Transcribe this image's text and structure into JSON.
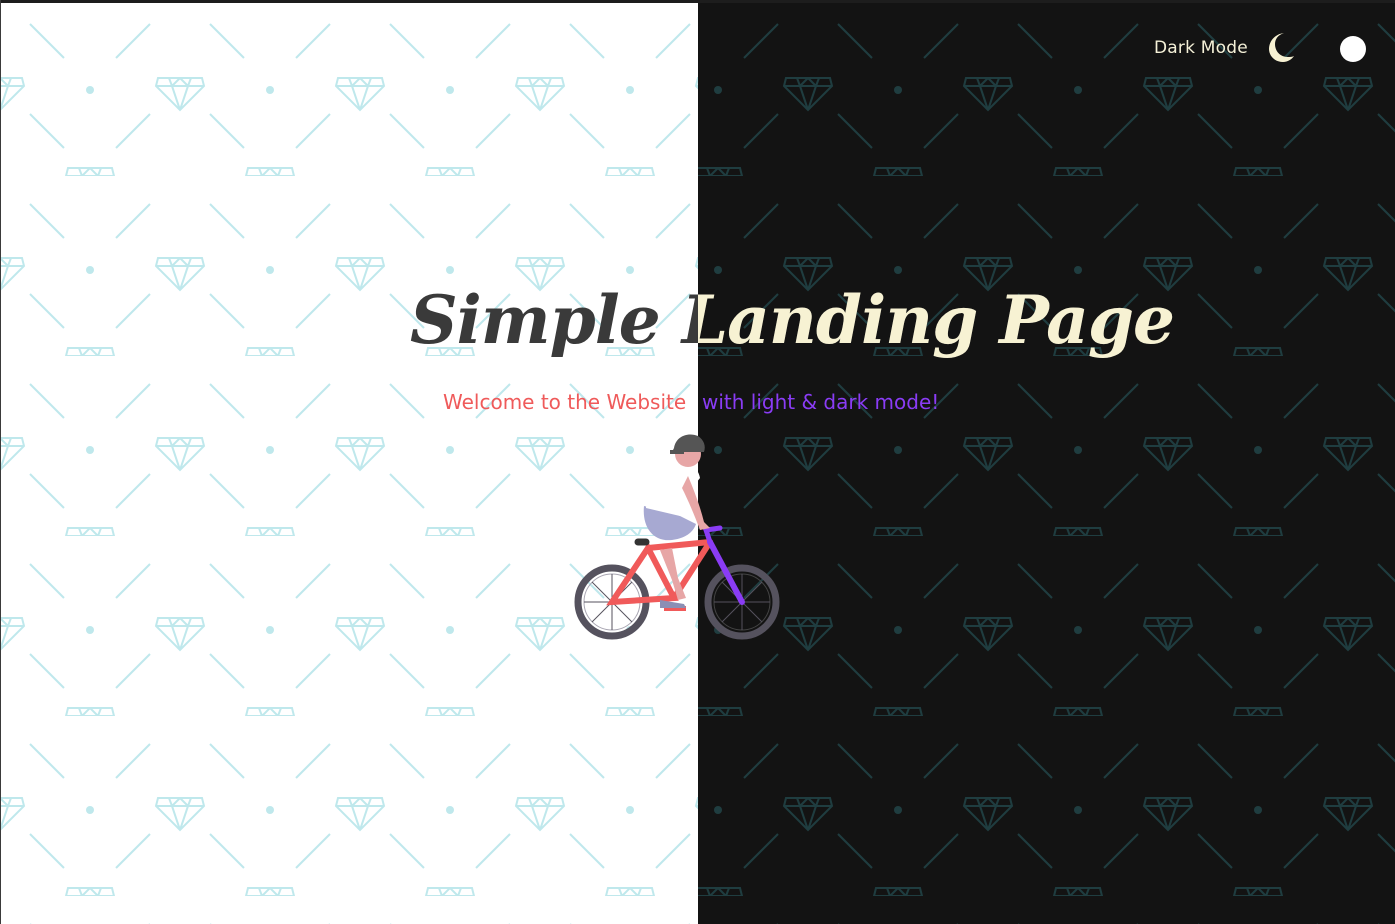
{
  "header": {
    "mode_label": "Dark Mode",
    "moon_icon": "crescent-moon-icon",
    "toggle": "mode-toggle"
  },
  "hero": {
    "title": "Simple Landing Page",
    "subtitle_light": "Welcome to the Website",
    "subtitle_dark": "with light & dark mode!"
  },
  "illustration": "person-riding-bicycle",
  "colors": {
    "light_bg": "#ffffff",
    "dark_bg": "#131313",
    "pattern_light": "#bfe8ec",
    "pattern_dark": "#1f3d40",
    "title_light": "#3a3a3a",
    "title_dark": "#f7f2d3",
    "subtitle_light": "#ef5a5a",
    "subtitle_dark": "#8a3cf5",
    "moon": "#f7f2d3"
  }
}
